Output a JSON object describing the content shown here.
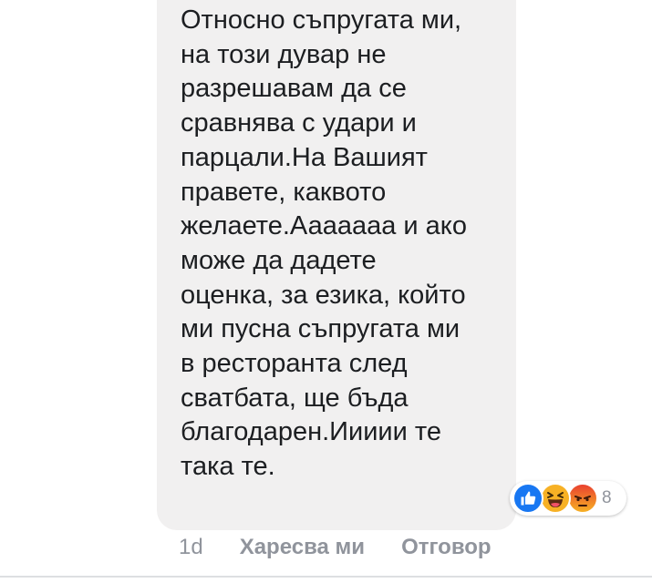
{
  "comment": {
    "lines": [
      "Относно съпругата ми,",
      "на този дувар не",
      "разрешавам да се",
      "сравнява с удари и",
      "парцали.На Вашият",
      "правете, каквото",
      "желаете.Ааааааа и ако",
      "може да дадете",
      "оценка, за езика, който",
      "ми пусна съпругата ми",
      "в ресторанта след",
      "сватбата, ще бъда",
      "благодарен.Иииии те",
      "така те."
    ]
  },
  "reactions": {
    "icons": [
      "like-icon",
      "haha-icon",
      "angry-icon"
    ],
    "count": "8",
    "colors": {
      "like": "#1877f2",
      "haha": "#f7b125",
      "angry": "#e9710f"
    }
  },
  "meta": {
    "time": "1d",
    "like_label": "Харесва ми",
    "reply_label": "Отговор"
  },
  "colors": {
    "bubble_bg": "#f1f0f0",
    "text": "#1c1e21",
    "meta_text": "#90949c"
  }
}
